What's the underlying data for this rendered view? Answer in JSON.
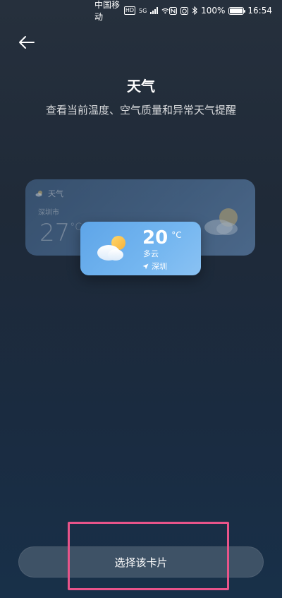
{
  "status_bar": {
    "carrier": "中国移动",
    "hd_badge": "HD",
    "network": "5G",
    "battery": "100%",
    "battery_level": 1.0,
    "time": "16:54"
  },
  "header": {
    "title": "天气",
    "subtitle": "查看当前温度、空气质量和异常天气提醒"
  },
  "preview_large": {
    "app_label": "天气",
    "location": "深圳市",
    "temperature": "27",
    "unit": "°C"
  },
  "preview_small": {
    "temperature": "20",
    "unit": "°C",
    "condition": "多云",
    "location": "深圳"
  },
  "action": {
    "select_label": "选择该卡片"
  },
  "colors": {
    "highlight": "#e8548a",
    "card_blue": "#74b6f0"
  },
  "icons": {
    "back": "back-arrow-icon",
    "weather": "partly-cloudy-icon",
    "location": "location-arrow-icon"
  }
}
